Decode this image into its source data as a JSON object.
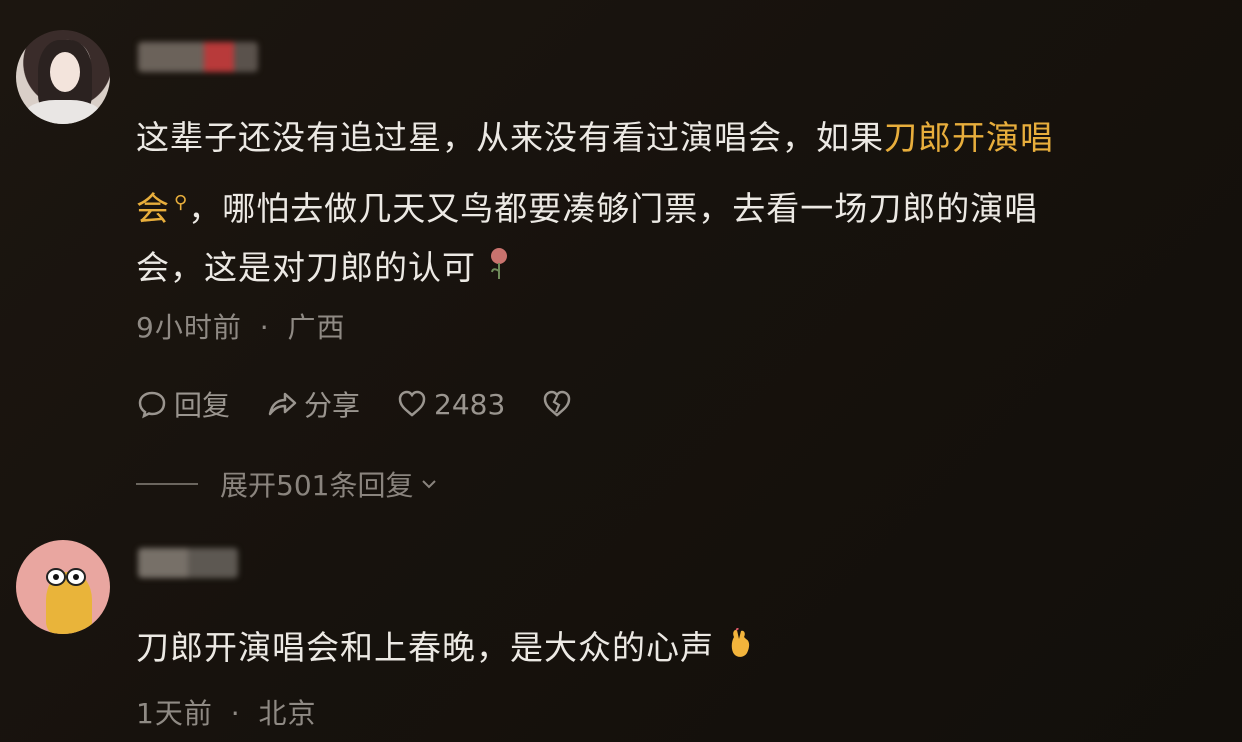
{
  "comments": [
    {
      "text_line1_prefix": "这辈子还没有追过星，从来没有看过演唱会，如果",
      "text_line1_highlight": "刀郎开演唱",
      "text_line2_highlight": "会",
      "text_line2_rest": "，哪怕去做几天又鸟都要凑够门票，去看一场刀郎的演唱",
      "text_line3": "会，这是对刀郎的认可",
      "time": "9小时前",
      "separator": "·",
      "location": "广西",
      "reply_label": "回复",
      "share_label": "分享",
      "like_count": "2483",
      "expand_label": "展开501条回复"
    },
    {
      "text": "刀郎开演唱会和上春晚，是大众的心声",
      "time": "1天前",
      "separator": "·",
      "location": "北京"
    }
  ],
  "icons": {
    "search": "search-icon",
    "reply": "chat-bubble-icon",
    "share": "share-arrow-icon",
    "like": "heart-icon",
    "dislike": "broken-heart-icon",
    "expand": "chevron-down-icon",
    "rose": "rose-emoji-icon",
    "finger_heart": "finger-heart-emoji-icon"
  },
  "colors": {
    "highlight": "#e8ae3c",
    "meta": "#8f8a84",
    "background": "#17120d"
  }
}
